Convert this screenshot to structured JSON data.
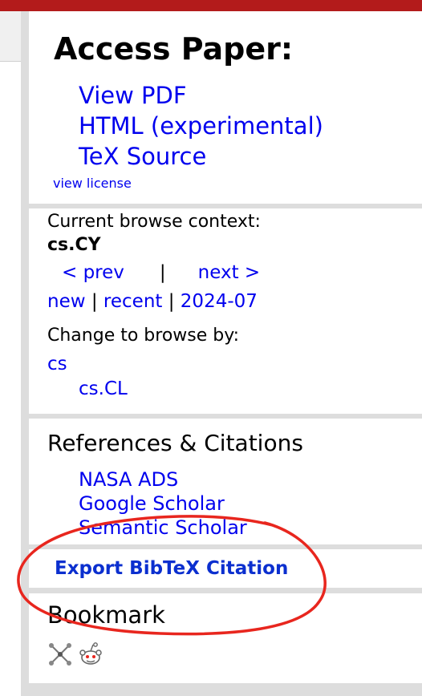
{
  "access": {
    "title": "Access Paper:",
    "links": [
      "View PDF",
      "HTML (experimental)",
      "TeX Source"
    ],
    "license": "view license"
  },
  "browse": {
    "context_label": "Current browse context:",
    "context_value": "cs.CY",
    "prev": "< prev",
    "separator": "|",
    "next": "next >",
    "new": "new",
    "recent": "recent",
    "date": "2024-07",
    "change_label": "Change to browse by:",
    "cs": "cs",
    "cs_cl": "cs.CL"
  },
  "references": {
    "title": "References & Citations",
    "links": [
      "NASA ADS",
      "Google Scholar",
      "Semantic Scholar"
    ]
  },
  "export": {
    "label": "Export BibTeX Citation"
  },
  "bookmark": {
    "title": "Bookmark",
    "icons": [
      "bibsonomy-icon",
      "reddit-icon"
    ]
  },
  "colors": {
    "header_bar": "#b31b1b",
    "link": "#0000ee",
    "highlight_ellipse": "#e8261e",
    "panel_separator": "#dddddd"
  }
}
